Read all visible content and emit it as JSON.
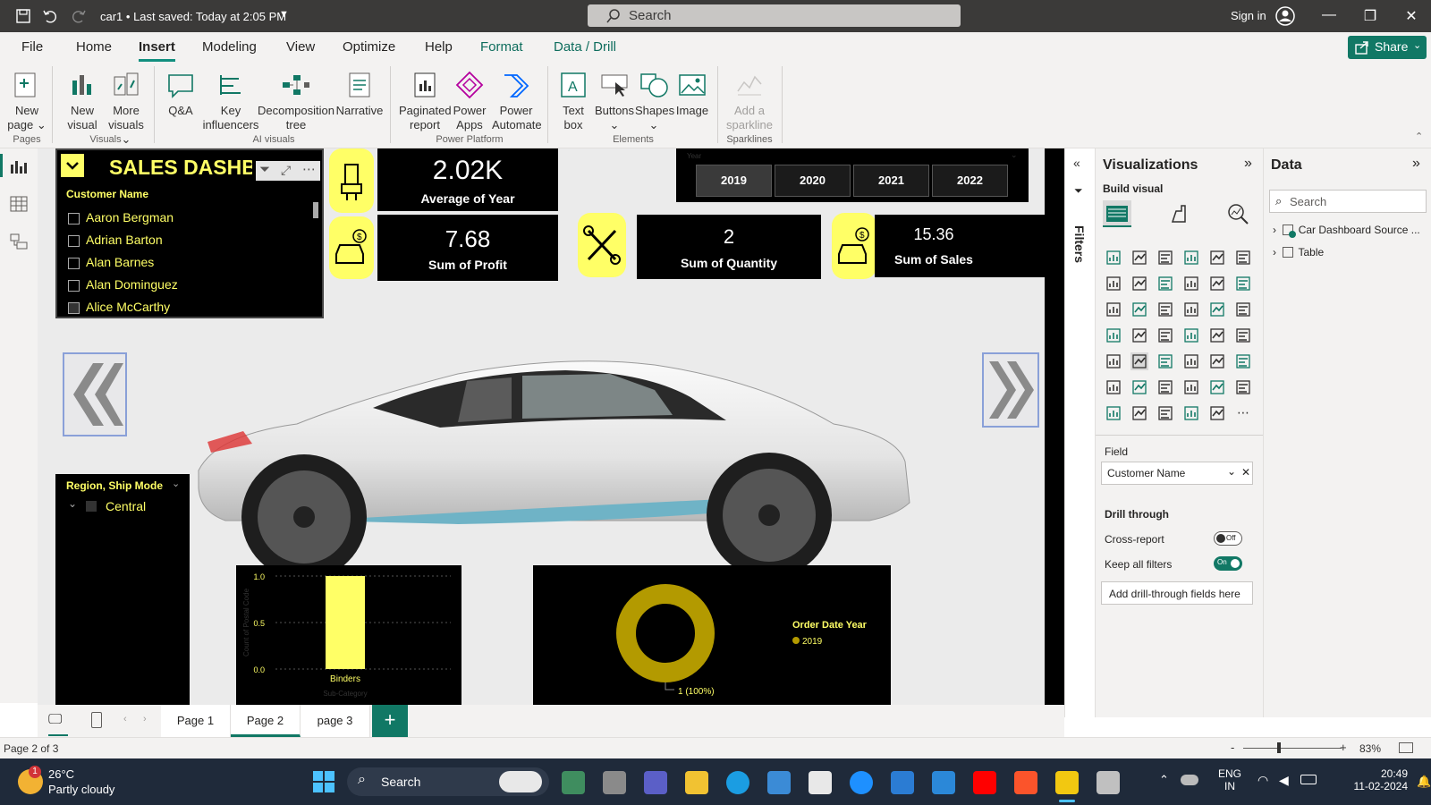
{
  "titlebar": {
    "doc_title": "car1 • Last saved: Today at 2:05 PM",
    "search_placeholder": "Search",
    "sign_in": "Sign in"
  },
  "menu": {
    "items": [
      "File",
      "Home",
      "Insert",
      "Modeling",
      "View",
      "Optimize",
      "Help",
      "Format",
      "Data / Drill"
    ],
    "active": "Insert",
    "share": "Share"
  },
  "ribbon": {
    "new_page": [
      "New",
      "page"
    ],
    "new_visual": [
      "New",
      "visual"
    ],
    "more_visuals": [
      "More",
      "visuals"
    ],
    "qa": "Q&A",
    "key_influencers": [
      "Key",
      "influencers"
    ],
    "decomposition_tree": [
      "Decomposition",
      "tree"
    ],
    "narrative": "Narrative",
    "paginated_report": [
      "Paginated",
      "report"
    ],
    "power_apps": [
      "Power",
      "Apps"
    ],
    "power_automate": [
      "Power",
      "Automate"
    ],
    "text_box": [
      "Text",
      "box"
    ],
    "buttons": "Buttons",
    "shapes": "Shapes",
    "image": "Image",
    "add_sparkline": [
      "Add a",
      "sparkline"
    ],
    "groups": [
      "Pages",
      "Visuals",
      "AI visuals",
      "Power Platform",
      "Elements",
      "Sparklines"
    ]
  },
  "canvas": {
    "title": "SALES DASHBO",
    "slicer_header": "Customer Name",
    "customers": [
      "Aaron Bergman",
      "Adrian Barton",
      "Alan Barnes",
      "Alan Dominguez",
      "Alice McCarthy"
    ],
    "year_slicer_label": "Year",
    "years": [
      "2019",
      "2020",
      "2021",
      "2022"
    ],
    "selected_year": "2019",
    "kpis": {
      "avg_year": {
        "value": "2.02K",
        "label": "Average of Year"
      },
      "profit": {
        "value": "7.68",
        "label": "Sum of Profit"
      },
      "quantity": {
        "value": "2",
        "label": "Sum of Quantity"
      },
      "sales": {
        "value": "15.36",
        "label": "Sum of Sales"
      }
    },
    "region_header": "Region, Ship Mode",
    "region_item": "Central",
    "accent": "#ffff66"
  },
  "chart_data": [
    {
      "type": "bar",
      "categories": [
        "Binders"
      ],
      "values": [
        1.0
      ],
      "xlabel": "Sub-Category",
      "ylabel": "Count of Postal Code",
      "yticks": [
        "1.0",
        "0.5",
        "0.0"
      ],
      "ylim": [
        0,
        1.0
      ],
      "color": "#ffff66"
    },
    {
      "type": "pie",
      "variant": "donut",
      "legend_title": "Order Date Year",
      "categories": [
        "2019"
      ],
      "values": [
        1
      ],
      "data_label": "1 (100%)",
      "color": "#b39a00"
    }
  ],
  "filters": {
    "label": "Filters"
  },
  "visualizations": {
    "title": "Visualizations",
    "build_visual": "Build visual",
    "field_label": "Field",
    "field_value": "Customer Name",
    "drill_through": "Drill through",
    "cross_report": "Cross-report",
    "cross_report_state": "Off",
    "keep_filters": "Keep all filters",
    "keep_filters_state": "On",
    "add_drill": "Add drill-through fields here"
  },
  "data": {
    "title": "Data",
    "search_placeholder": "Search",
    "tables": [
      "Car Dashboard Source ...",
      "Table"
    ]
  },
  "pages": {
    "tabs": [
      "Page 1",
      "Page 2",
      "page 3"
    ],
    "active": "Page 2",
    "status": "Page 2 of 3",
    "zoom": "83%"
  },
  "taskbar": {
    "temp": "26°C",
    "weather": "Partly cloudy",
    "search": "Search",
    "lang": [
      "ENG",
      "IN"
    ],
    "time": "20:49",
    "date": "11-02-2024",
    "notification": "1"
  }
}
